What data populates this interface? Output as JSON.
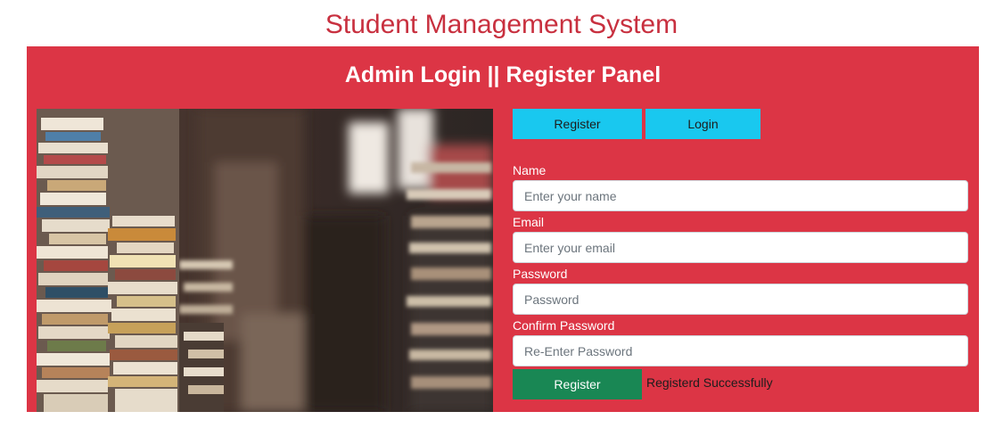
{
  "page": {
    "title": "Student Management System"
  },
  "panel": {
    "title": "Admin Login || Register Panel"
  },
  "tabs": {
    "register_label": "Register",
    "login_label": "Login"
  },
  "form": {
    "fields": [
      {
        "label": "Name",
        "placeholder": "Enter your name",
        "value": ""
      },
      {
        "label": "Email",
        "placeholder": "Enter your email",
        "value": ""
      },
      {
        "label": "Password",
        "placeholder": "Password",
        "value": ""
      },
      {
        "label": "Confirm Password",
        "placeholder": "Re-Enter Password",
        "value": ""
      }
    ],
    "submit_label": "Register",
    "status_message": "Registerd Successfully"
  },
  "colors": {
    "title": "#c8303f",
    "panel": "#dc3545",
    "tab_button": "#19c8ef",
    "submit_button": "#198754"
  },
  "image": {
    "subject": "stacks of books in a bookshop"
  }
}
